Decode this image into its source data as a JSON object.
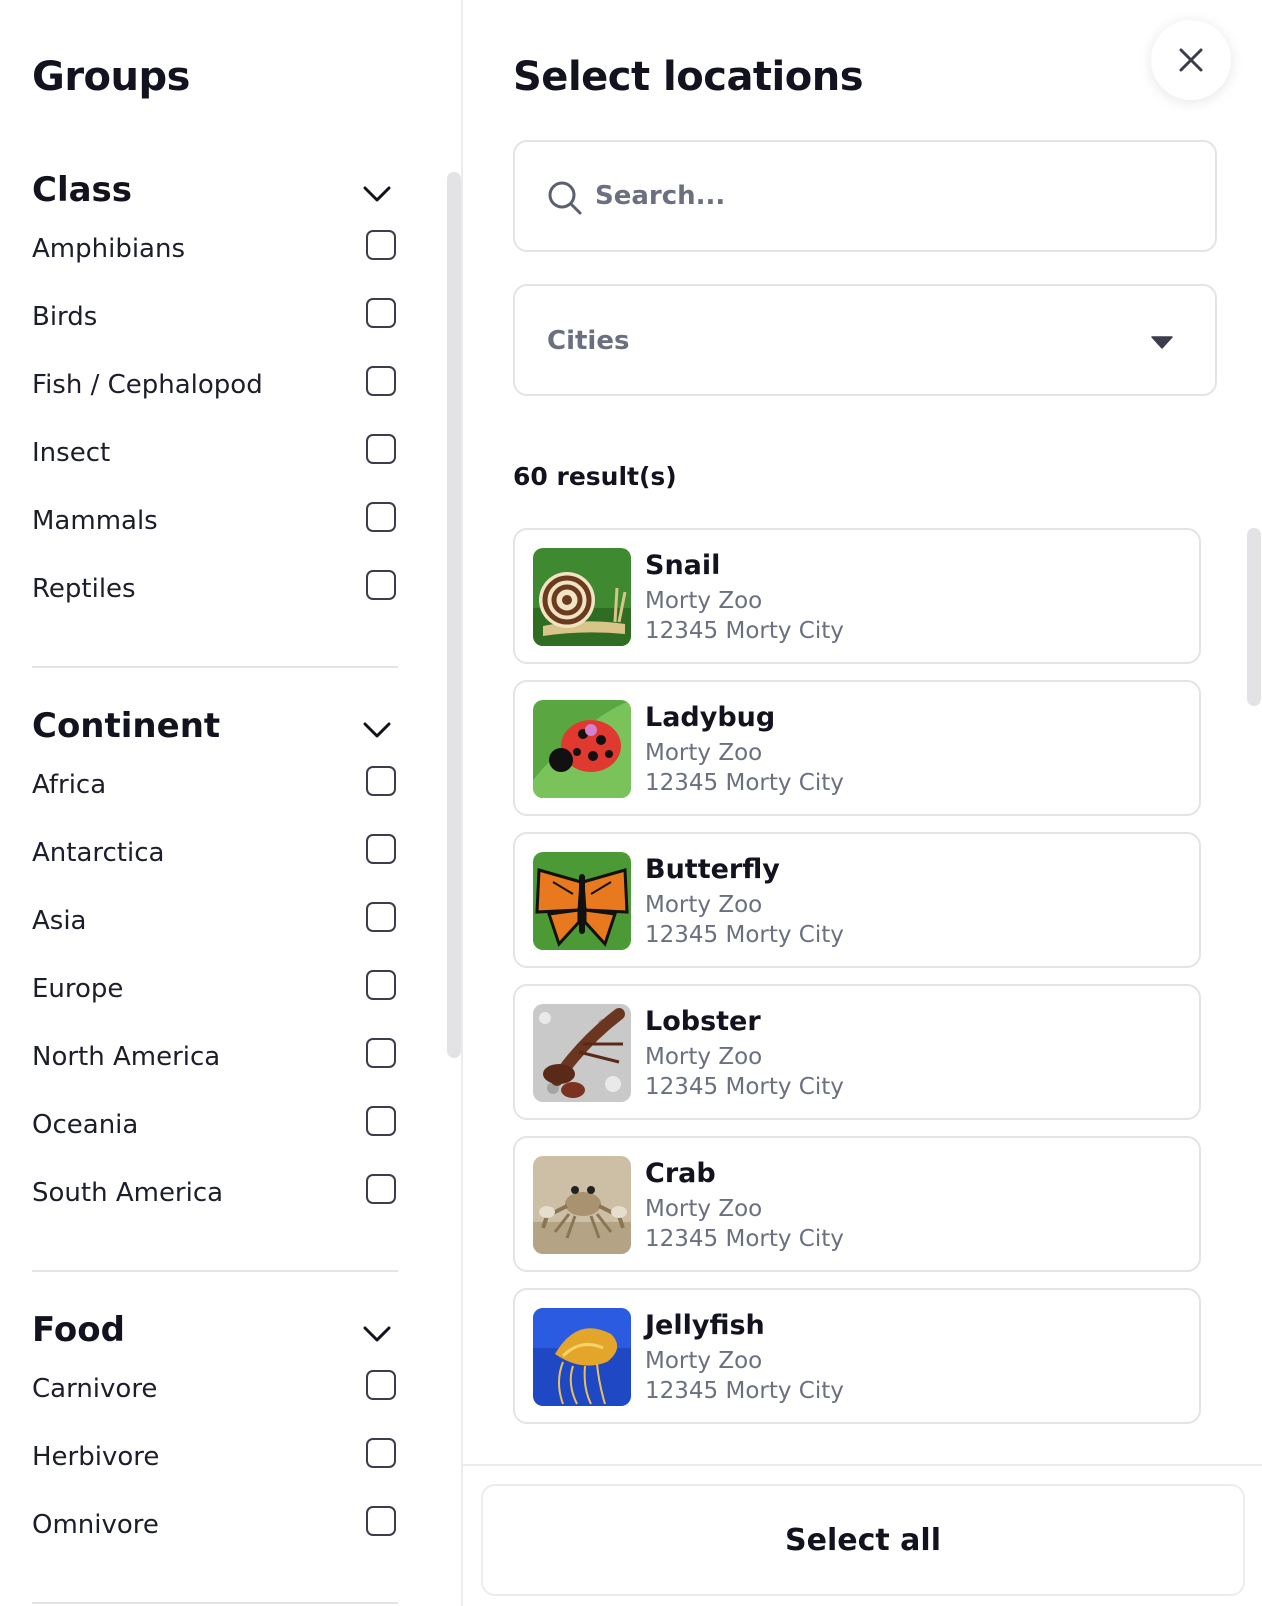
{
  "groups_panel": {
    "title": "Groups",
    "groups": [
      {
        "title": "Class",
        "options": [
          "Amphibians",
          "Birds",
          "Fish / Cephalopod",
          "Insect",
          "Mammals",
          "Reptiles"
        ]
      },
      {
        "title": "Continent",
        "options": [
          "Africa",
          "Antarctica",
          "Asia",
          "Europe",
          "North America",
          "Oceania",
          "South America"
        ]
      },
      {
        "title": "Food",
        "options": [
          "Carnivore",
          "Herbivore",
          "Omnivore"
        ]
      }
    ]
  },
  "locations_panel": {
    "title": "Select locations",
    "search": {
      "placeholder": "Search..."
    },
    "cities_select": {
      "selected": "Cities"
    },
    "results_count": "60 result(s)",
    "results": [
      {
        "name": "Snail",
        "place": "Morty Zoo",
        "address": "12345 Morty City"
      },
      {
        "name": "Ladybug",
        "place": "Morty Zoo",
        "address": "12345 Morty City"
      },
      {
        "name": "Butterfly",
        "place": "Morty Zoo",
        "address": "12345 Morty City"
      },
      {
        "name": "Lobster",
        "place": "Morty Zoo",
        "address": "12345 Morty City"
      },
      {
        "name": "Crab",
        "place": "Morty Zoo",
        "address": "12345 Morty City"
      },
      {
        "name": "Jellyfish",
        "place": "Morty Zoo",
        "address": "12345 Morty City"
      }
    ],
    "select_all_label": "Select all"
  },
  "icons": {
    "close": "close-icon",
    "search": "search-icon",
    "dropdown": "caret-down-icon",
    "group_toggle": "chevron-down-icon",
    "checkbox": "checkbox-unchecked"
  }
}
